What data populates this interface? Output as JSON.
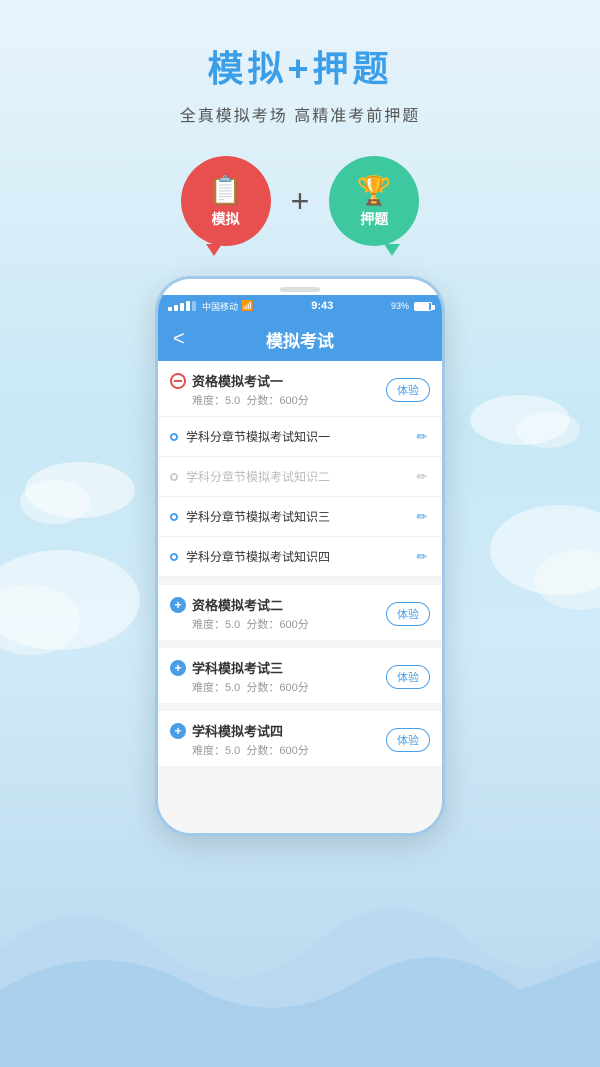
{
  "page": {
    "background_color": "#d0eaf8"
  },
  "header": {
    "title": "模拟+押题",
    "subtitle": "全真模拟考场 高精准考前押题"
  },
  "icons": {
    "plus": "+",
    "left_icon": {
      "label": "模拟",
      "color": "#e85050",
      "symbol": "📋"
    },
    "right_icon": {
      "label": "押题",
      "color": "#3dc8a0",
      "symbol": "🏆"
    }
  },
  "phone": {
    "status_bar": {
      "carrier": "中国移动",
      "wifi": "WiFi",
      "time": "9:43",
      "battery": "93%"
    },
    "nav": {
      "title": "模拟考试",
      "back_label": "<"
    },
    "exam_list": [
      {
        "id": "section1",
        "type": "expandable_minus",
        "title": "资格模拟考试一",
        "difficulty": "难度：5.0",
        "score": "分数：600分",
        "tag": "体验",
        "sub_items": [
          {
            "text": "学科分章节模拟考试知识一",
            "edit": true,
            "dot_active": true
          },
          {
            "text": "学科分章节模拟考试知识二",
            "edit": false,
            "dot_active": false
          },
          {
            "text": "学科分章节模拟考试知识三",
            "edit": true,
            "dot_active": true
          },
          {
            "text": "学科分章节模拟考试知识四",
            "edit": true,
            "dot_active": true
          }
        ]
      },
      {
        "id": "section2",
        "type": "plus",
        "title": "资格模拟考试二",
        "difficulty": "难度：5.0",
        "score": "分数：600分",
        "tag": "体验",
        "sub_items": []
      },
      {
        "id": "section3",
        "type": "plus",
        "title": "学科模拟考试三",
        "difficulty": "难度：5.0",
        "score": "分数：600分",
        "tag": "体验",
        "sub_items": []
      },
      {
        "id": "section4",
        "type": "plus",
        "title": "学科模拟考试四",
        "difficulty": "难度：5.0",
        "score": "分数：600分",
        "tag": "体验",
        "sub_items": []
      }
    ]
  }
}
